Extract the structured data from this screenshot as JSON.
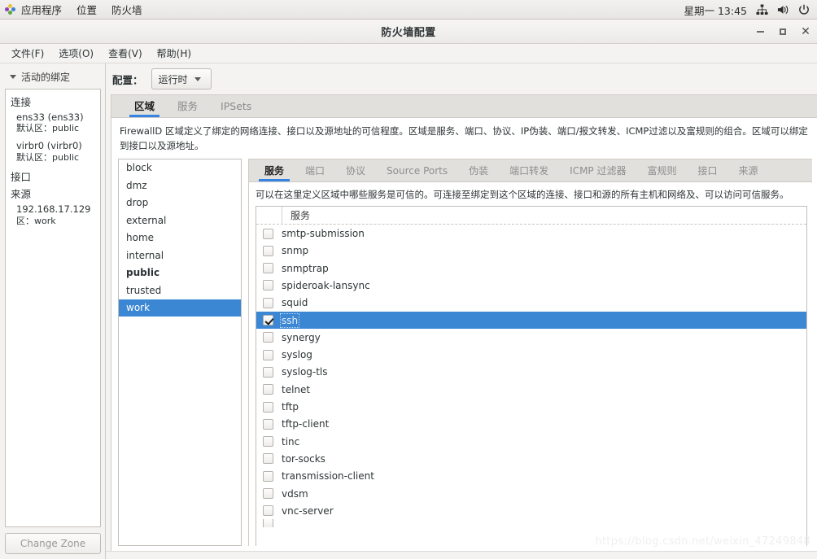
{
  "desktop_panel": {
    "logo_icon": "gnome-logo-icon",
    "menus": [
      "应用程序",
      "位置",
      "防火墙"
    ],
    "tray": {
      "clock": "星期一 13:45",
      "icons": [
        "network-icon",
        "volume-icon",
        "power-icon"
      ]
    }
  },
  "window": {
    "title": "防火墙配置",
    "controls": {
      "minimize": "minimize-icon",
      "maximize": "maximize-icon",
      "close": "close-icon"
    },
    "menubar": [
      "文件(F)",
      "选项(O)",
      "查看(V)",
      "帮助(H)"
    ]
  },
  "sidebar": {
    "header": "活动的绑定",
    "groups": [
      {
        "title": "连接",
        "entries": [
          {
            "name": "ens33 (ens33)",
            "sub": "默认区：public"
          },
          {
            "name": "virbr0 (virbr0)",
            "sub": "默认区：public"
          }
        ]
      },
      {
        "title": "接口",
        "entries": []
      },
      {
        "title": "来源",
        "entries": [
          {
            "name": "192.168.17.129",
            "sub": "区：work"
          }
        ]
      }
    ],
    "change_zone_button": "Change Zone"
  },
  "toolbar": {
    "config_label": "配置：",
    "config_value": "运行时"
  },
  "outer_tabs": [
    {
      "label": "区域",
      "active": true
    },
    {
      "label": "服务",
      "active": false
    },
    {
      "label": "IPSets",
      "active": false
    }
  ],
  "zone_description": "FirewallD 区域定义了绑定的网络连接、接口以及源地址的可信程度。区域是服务、端口、协议、IP伪装、端口/报文转发、ICMP过滤以及富规则的组合。区域可以绑定到接口以及源地址。",
  "zones": [
    {
      "name": "block",
      "bold": false,
      "selected": false
    },
    {
      "name": "dmz",
      "bold": false,
      "selected": false
    },
    {
      "name": "drop",
      "bold": false,
      "selected": false
    },
    {
      "name": "external",
      "bold": false,
      "selected": false
    },
    {
      "name": "home",
      "bold": false,
      "selected": false
    },
    {
      "name": "internal",
      "bold": false,
      "selected": false
    },
    {
      "name": "public",
      "bold": true,
      "selected": false
    },
    {
      "name": "trusted",
      "bold": false,
      "selected": false
    },
    {
      "name": "work",
      "bold": false,
      "selected": true
    }
  ],
  "inner_tabs": [
    {
      "label": "服务",
      "active": true
    },
    {
      "label": "端口",
      "active": false
    },
    {
      "label": "协议",
      "active": false
    },
    {
      "label": "Source Ports",
      "active": false
    },
    {
      "label": "伪装",
      "active": false
    },
    {
      "label": "端口转发",
      "active": false
    },
    {
      "label": "ICMP 过滤器",
      "active": false
    },
    {
      "label": "富规则",
      "active": false
    },
    {
      "label": "接口",
      "active": false
    },
    {
      "label": "来源",
      "active": false
    }
  ],
  "service_description": "可以在这里定义区域中哪些服务是可信的。可连接至绑定到这个区域的连接、接口和源的所有主机和网络及、可以访问可信服务。",
  "service_table": {
    "column_header": "服务",
    "rows": [
      {
        "name": "smtp-submission",
        "checked": false,
        "selected": false
      },
      {
        "name": "snmp",
        "checked": false,
        "selected": false
      },
      {
        "name": "snmptrap",
        "checked": false,
        "selected": false
      },
      {
        "name": "spideroak-lansync",
        "checked": false,
        "selected": false
      },
      {
        "name": "squid",
        "checked": false,
        "selected": false
      },
      {
        "name": "ssh",
        "checked": true,
        "selected": true
      },
      {
        "name": "synergy",
        "checked": false,
        "selected": false
      },
      {
        "name": "syslog",
        "checked": false,
        "selected": false
      },
      {
        "name": "syslog-tls",
        "checked": false,
        "selected": false
      },
      {
        "name": "telnet",
        "checked": false,
        "selected": false
      },
      {
        "name": "tftp",
        "checked": false,
        "selected": false
      },
      {
        "name": "tftp-client",
        "checked": false,
        "selected": false
      },
      {
        "name": "tinc",
        "checked": false,
        "selected": false
      },
      {
        "name": "tor-socks",
        "checked": false,
        "selected": false
      },
      {
        "name": "transmission-client",
        "checked": false,
        "selected": false
      },
      {
        "name": "vdsm",
        "checked": false,
        "selected": false
      },
      {
        "name": "vnc-server",
        "checked": false,
        "selected": false
      },
      {
        "name": "",
        "checked": false,
        "selected": false,
        "partial": true
      }
    ]
  },
  "watermark": "https://blog.csdn.net/weixin_47249848",
  "colors": {
    "selection_blue": "#3b87d3",
    "tab_underline": "#3584e4",
    "panel_bg": "#f4f3f2",
    "window_bg": "#ffffff"
  }
}
